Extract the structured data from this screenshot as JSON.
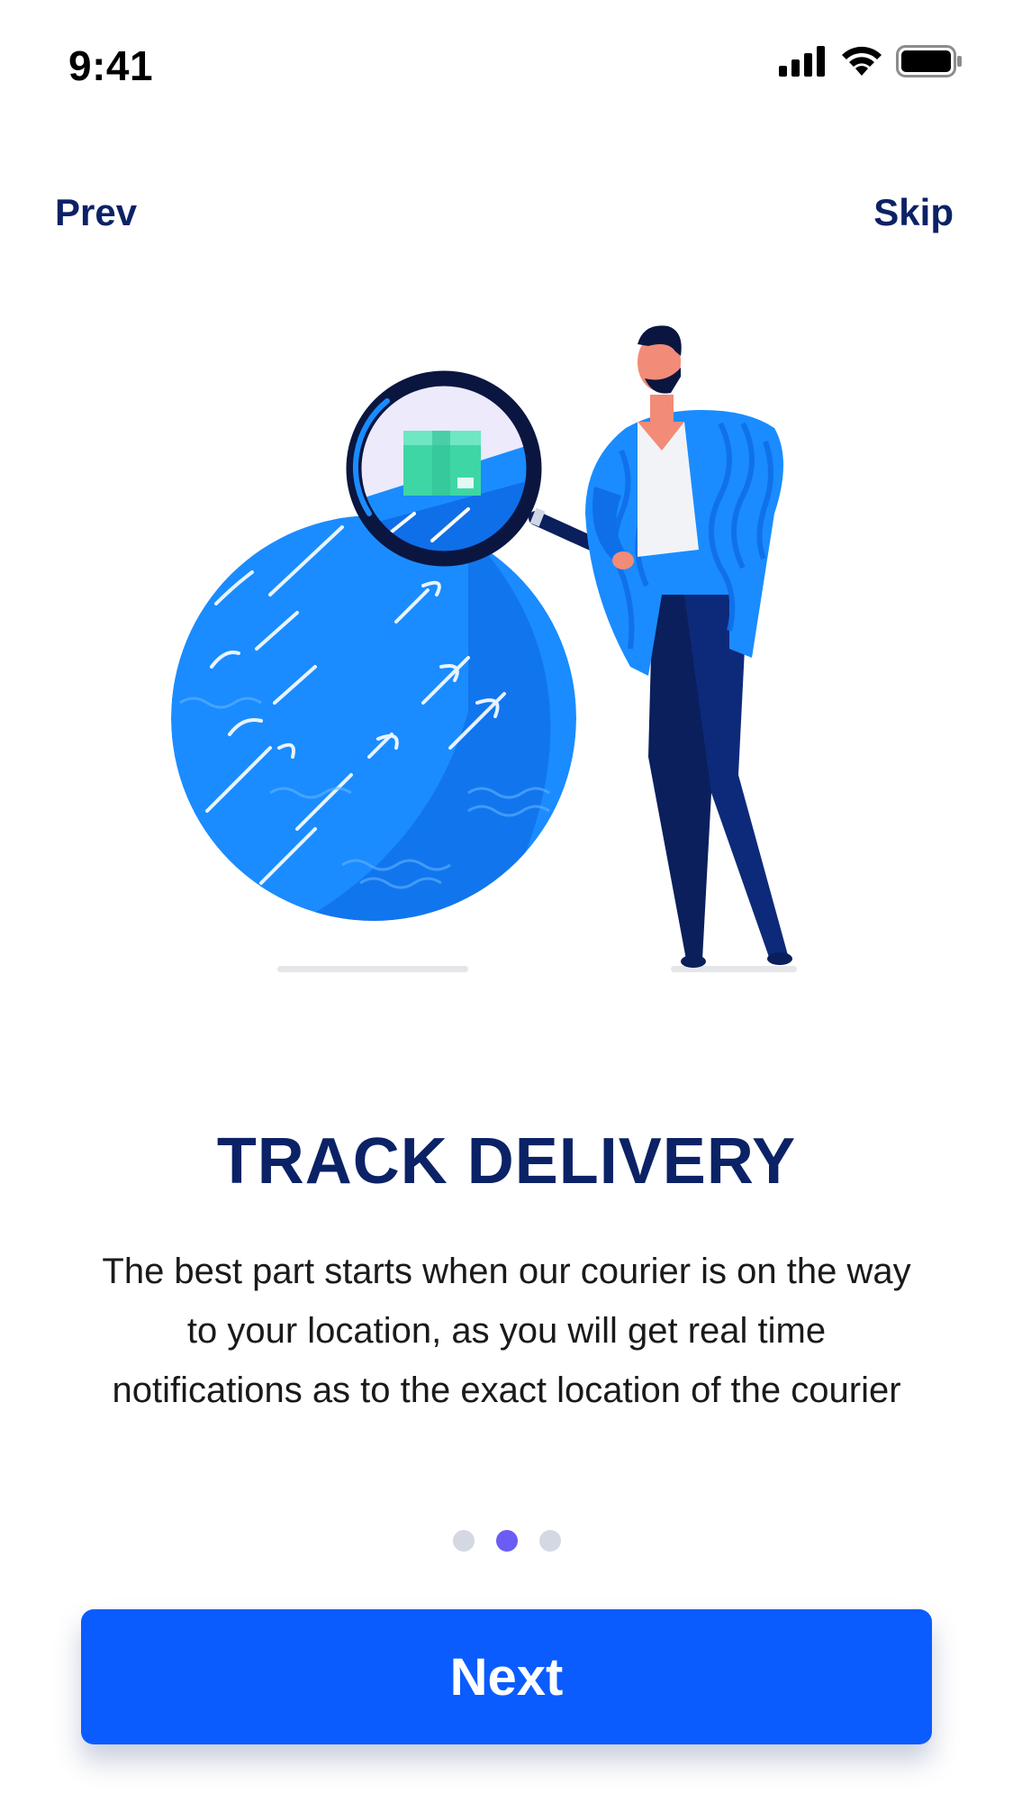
{
  "status_bar": {
    "time": "9:41",
    "icons": [
      "signal-icon",
      "wifi-icon",
      "battery-icon"
    ]
  },
  "nav": {
    "prev_label": "Prev",
    "skip_label": "Skip"
  },
  "content": {
    "title": "TRACK DELIVERY",
    "description": "The best part starts when our courier is on the way to your location, as you will get real time notifications as to the exact location of the courier"
  },
  "pager": {
    "total": 3,
    "active_index": 1
  },
  "actions": {
    "next_label": "Next"
  },
  "colors": {
    "primary": "#0a5cff",
    "heading": "#0b2266",
    "dot_active": "#6b5cf5",
    "dot_inactive": "#d4d8e2"
  }
}
